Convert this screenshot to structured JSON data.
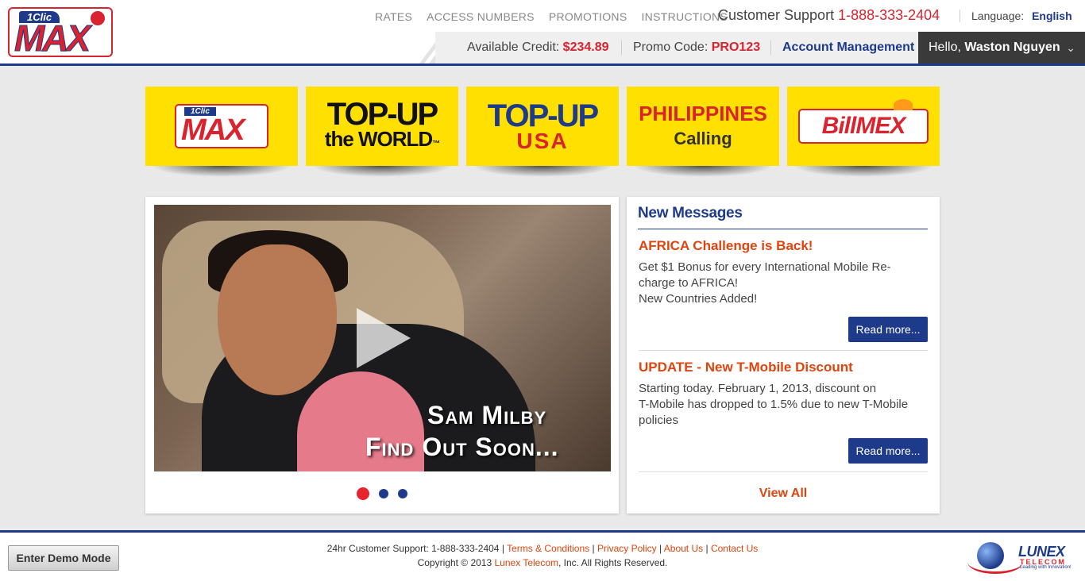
{
  "header": {
    "logo": {
      "badge": "1Clic",
      "wordmark": "MAX"
    },
    "nav": [
      "RATES",
      "ACCESS NUMBERS",
      "PROMOTIONS",
      "INSTRUCTIONS"
    ],
    "support_label": "Customer Support",
    "support_number": "1-888-333-2404",
    "language_label": "Language:",
    "language_value": "English",
    "credit_label": "Available Credit:",
    "credit_value": "$234.89",
    "promo_label": "Promo Code:",
    "promo_value": "PRO123",
    "account_management": "Account Management",
    "hello_label": "Hello,",
    "user_name": "Waston Nguyen",
    "chevron_icon": "chevron-down-icon"
  },
  "tiles": [
    {
      "name": "1Clic MAX",
      "badge": "1Clic",
      "wordmark": "MAX"
    },
    {
      "name": "Top-Up the World",
      "line1": "TOP-UP",
      "line2": "the WORLD",
      "tm": "™"
    },
    {
      "name": "Top-Up USA",
      "line1": "TOP-UP",
      "line2": "USA"
    },
    {
      "name": "Philippines Calling",
      "line1": "PHILIPPINES",
      "line2": "Calling"
    },
    {
      "name": "BillMEX",
      "wordmark": "BillMEX"
    }
  ],
  "video": {
    "caption_line1": "Sam Milby",
    "caption_line2": "Find Out Soon...",
    "play_icon": "play-icon",
    "slides": [
      {
        "active": true
      },
      {
        "active": false
      },
      {
        "active": false
      }
    ]
  },
  "messages": {
    "title": "New Messages",
    "items": [
      {
        "heading": "AFRICA Challenge is Back!",
        "body_line1": "Get $1 Bonus for every International Mobile Re-",
        "body_line2": "charge to AFRICA!",
        "body_line3": "New Countries Added!",
        "read_more": "Read more..."
      },
      {
        "heading": "UPDATE - New T-Mobile Discount",
        "body_line1": "Starting today. February 1, 2013, discount on",
        "body_line2": "T-Mobile has dropped to 1.5% due to new T-Mobile",
        "body_line3": "policies",
        "read_more": "Read more..."
      }
    ],
    "view_all": "View All"
  },
  "footer": {
    "demo_button": "Enter Demo Mode",
    "support_text": "24hr Customer Support: 1-888-333-2404",
    "sep": "|",
    "links": [
      "Terms & Conditions",
      "Privacy Policy",
      "About Us",
      "Contact Us"
    ],
    "copyright_prefix": "Copyright © 2013",
    "copyright_link": "Lunex Telecom",
    "copyright_suffix": ", Inc. All Rights Reserved.",
    "partner_name": "LUNEX",
    "partner_sub": "TELECOM",
    "partner_tagline": "Leading with Innovation!"
  },
  "colors": {
    "brand_red": "#d9232e",
    "brand_blue": "#1e3a8a",
    "accent_orange": "#e0440e",
    "tile_yellow": "#ffe000"
  }
}
